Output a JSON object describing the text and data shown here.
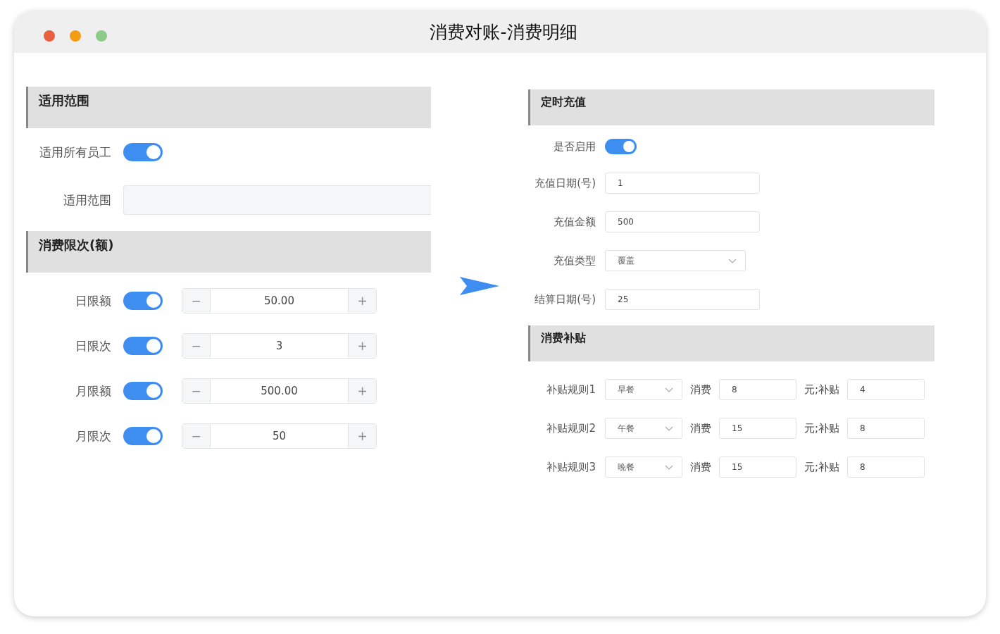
{
  "window": {
    "title": "消费对账-消费明细"
  },
  "scope": {
    "title": "适用范围",
    "all_employees": {
      "label": "适用所有员工",
      "on": true
    },
    "range": {
      "label": "适用范围"
    }
  },
  "limits": {
    "title": "消费限次(额)",
    "rows": [
      {
        "label": "日限额",
        "on": true,
        "value": "50.00",
        "minus": "−",
        "plus": "+"
      },
      {
        "label": "日限次",
        "on": true,
        "value": "3",
        "minus": "−",
        "plus": "+"
      },
      {
        "label": "月限额",
        "on": true,
        "value": "500.00",
        "minus": "−",
        "plus": "+"
      },
      {
        "label": "月限次",
        "on": true,
        "value": "50",
        "minus": "−",
        "plus": "+"
      }
    ]
  },
  "recharge": {
    "title": "定时充值",
    "fields": [
      {
        "kind": "toggle",
        "label": "是否启用",
        "on": true
      },
      {
        "kind": "input",
        "label": "充值日期(号)",
        "value": "1"
      },
      {
        "kind": "input",
        "label": "充值金额",
        "value": "500"
      },
      {
        "kind": "select",
        "label": "充值类型",
        "value": "覆盖"
      },
      {
        "kind": "input",
        "label": "结算日期(号)",
        "value": "25"
      }
    ]
  },
  "subsidy": {
    "title": "消费补贴",
    "rules": [
      {
        "label": "补贴规则1",
        "meal": "早餐",
        "spend_label": "消费",
        "spend": "8",
        "subsidy_label": "元;补贴",
        "subsidy": "4"
      },
      {
        "label": "补贴规则2",
        "meal": "午餐",
        "spend_label": "消费",
        "spend": "15",
        "subsidy_label": "元;补贴",
        "subsidy": "8"
      },
      {
        "label": "补贴规则3",
        "meal": "晚餐",
        "spend_label": "消费",
        "spend": "15",
        "subsidy_label": "元;补贴",
        "subsidy": "8"
      }
    ]
  }
}
